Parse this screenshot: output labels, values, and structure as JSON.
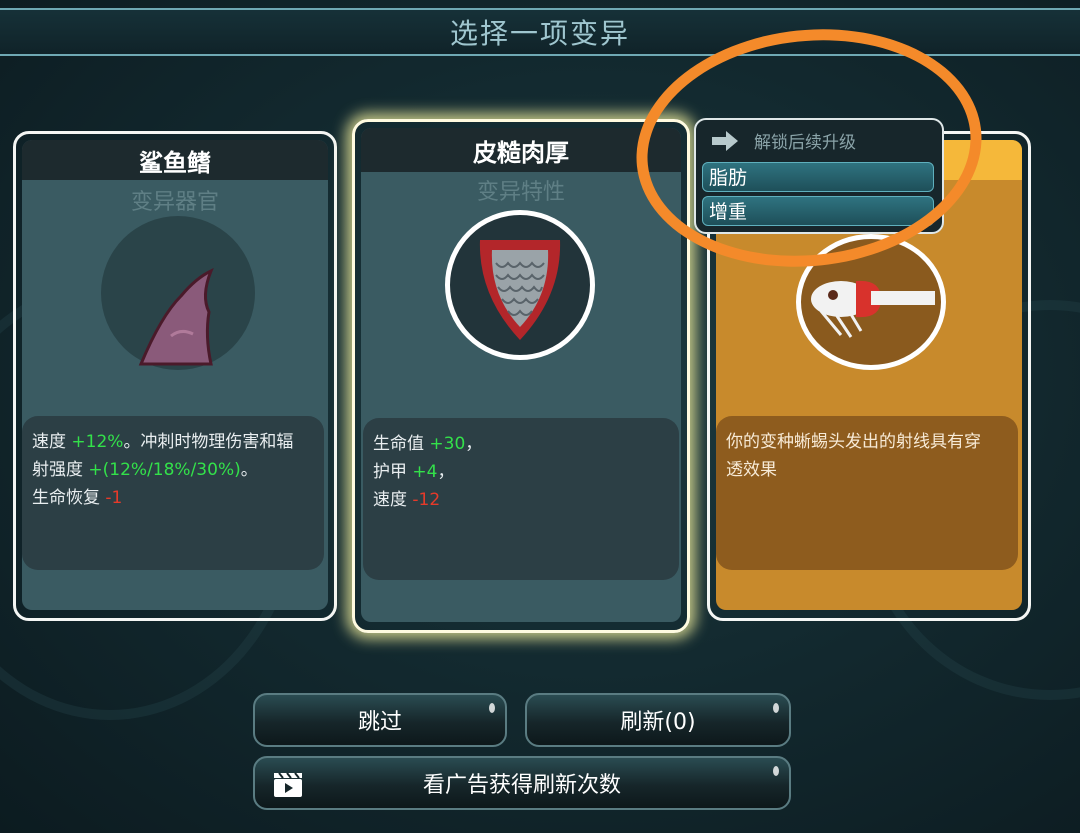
{
  "header": {
    "title": "选择一项变异"
  },
  "cards": [
    {
      "title": "鲨鱼鳍",
      "subtitle": "变异器官",
      "icon": "shark-fin-icon",
      "desc": [
        {
          "parts": [
            "速度 ",
            "+12%",
            "。冲刺时物理伤害和辐"
          ]
        },
        {
          "parts": [
            "射强度 ",
            "+(12%/18%/30%)",
            "。"
          ]
        },
        {
          "parts": [
            "生命恢复 ",
            "-1"
          ]
        }
      ]
    },
    {
      "title": "皮糙肉厚",
      "subtitle": "变异特性",
      "icon": "scale-shield-icon",
      "desc": [
        {
          "parts": [
            "生命值 ",
            "+30",
            "，"
          ]
        },
        {
          "parts": [
            "护甲 ",
            "+4",
            "，"
          ]
        },
        {
          "parts": [
            "速度 ",
            "-12"
          ]
        }
      ]
    },
    {
      "title": "",
      "subtitle": "",
      "icon": "lizard-laser-icon",
      "desc": [
        {
          "parts": [
            "你的变种蜥蜴头发出的射线具有穿"
          ]
        },
        {
          "parts": [
            "透效果"
          ]
        }
      ]
    }
  ],
  "popup": {
    "header": "解锁后续升级",
    "icon": "arrow-right-icon",
    "items": [
      "脂肪",
      "增重"
    ]
  },
  "buttons": {
    "skip": "跳过",
    "refresh": "刷新(0)",
    "watch_ad": "看广告获得刷新次数",
    "watch_ad_icon": "clapperboard-icon"
  },
  "colors": {
    "positive": "#33e14a",
    "negative": "#e63a2a",
    "gold_card": "#c88a2c",
    "annotation": "#f48a2a"
  }
}
